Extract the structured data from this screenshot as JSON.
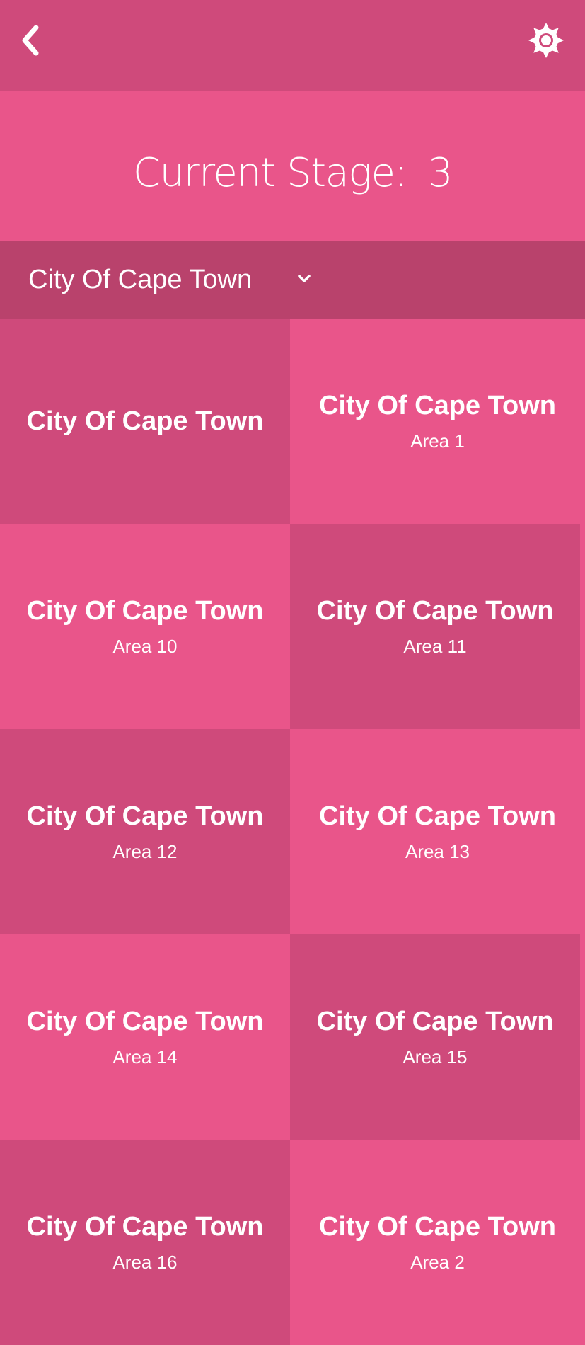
{
  "header": {
    "back_icon": "chevron-left-icon",
    "settings_icon": "sun-gear-icon",
    "background": "#cf4a7b"
  },
  "stage": {
    "label": "Current Stage:",
    "value": "3",
    "background": "#e9558a"
  },
  "municipality_select": {
    "selected": "City Of Cape Town",
    "icon": "chevron-down-icon",
    "background": "#b9426c"
  },
  "areas": [
    {
      "title": "City Of Cape Town",
      "subtitle": ""
    },
    {
      "title": "City Of Cape Town",
      "subtitle": "Area 1"
    },
    {
      "title": "City Of Cape Town",
      "subtitle": "Area 10"
    },
    {
      "title": "City Of Cape Town",
      "subtitle": "Area 11"
    },
    {
      "title": "City Of Cape Town",
      "subtitle": "Area 12"
    },
    {
      "title": "City Of Cape Town",
      "subtitle": "Area 13"
    },
    {
      "title": "City Of Cape Town",
      "subtitle": "Area 14"
    },
    {
      "title": "City Of Cape Town",
      "subtitle": "Area 15"
    },
    {
      "title": "City Of Cape Town",
      "subtitle": "Area 16"
    },
    {
      "title": "City Of Cape Town",
      "subtitle": "Area 2"
    }
  ],
  "colors": {
    "tile_dark": "#cf4a7b",
    "tile_light": "#e9558a",
    "text": "#ffffff"
  }
}
